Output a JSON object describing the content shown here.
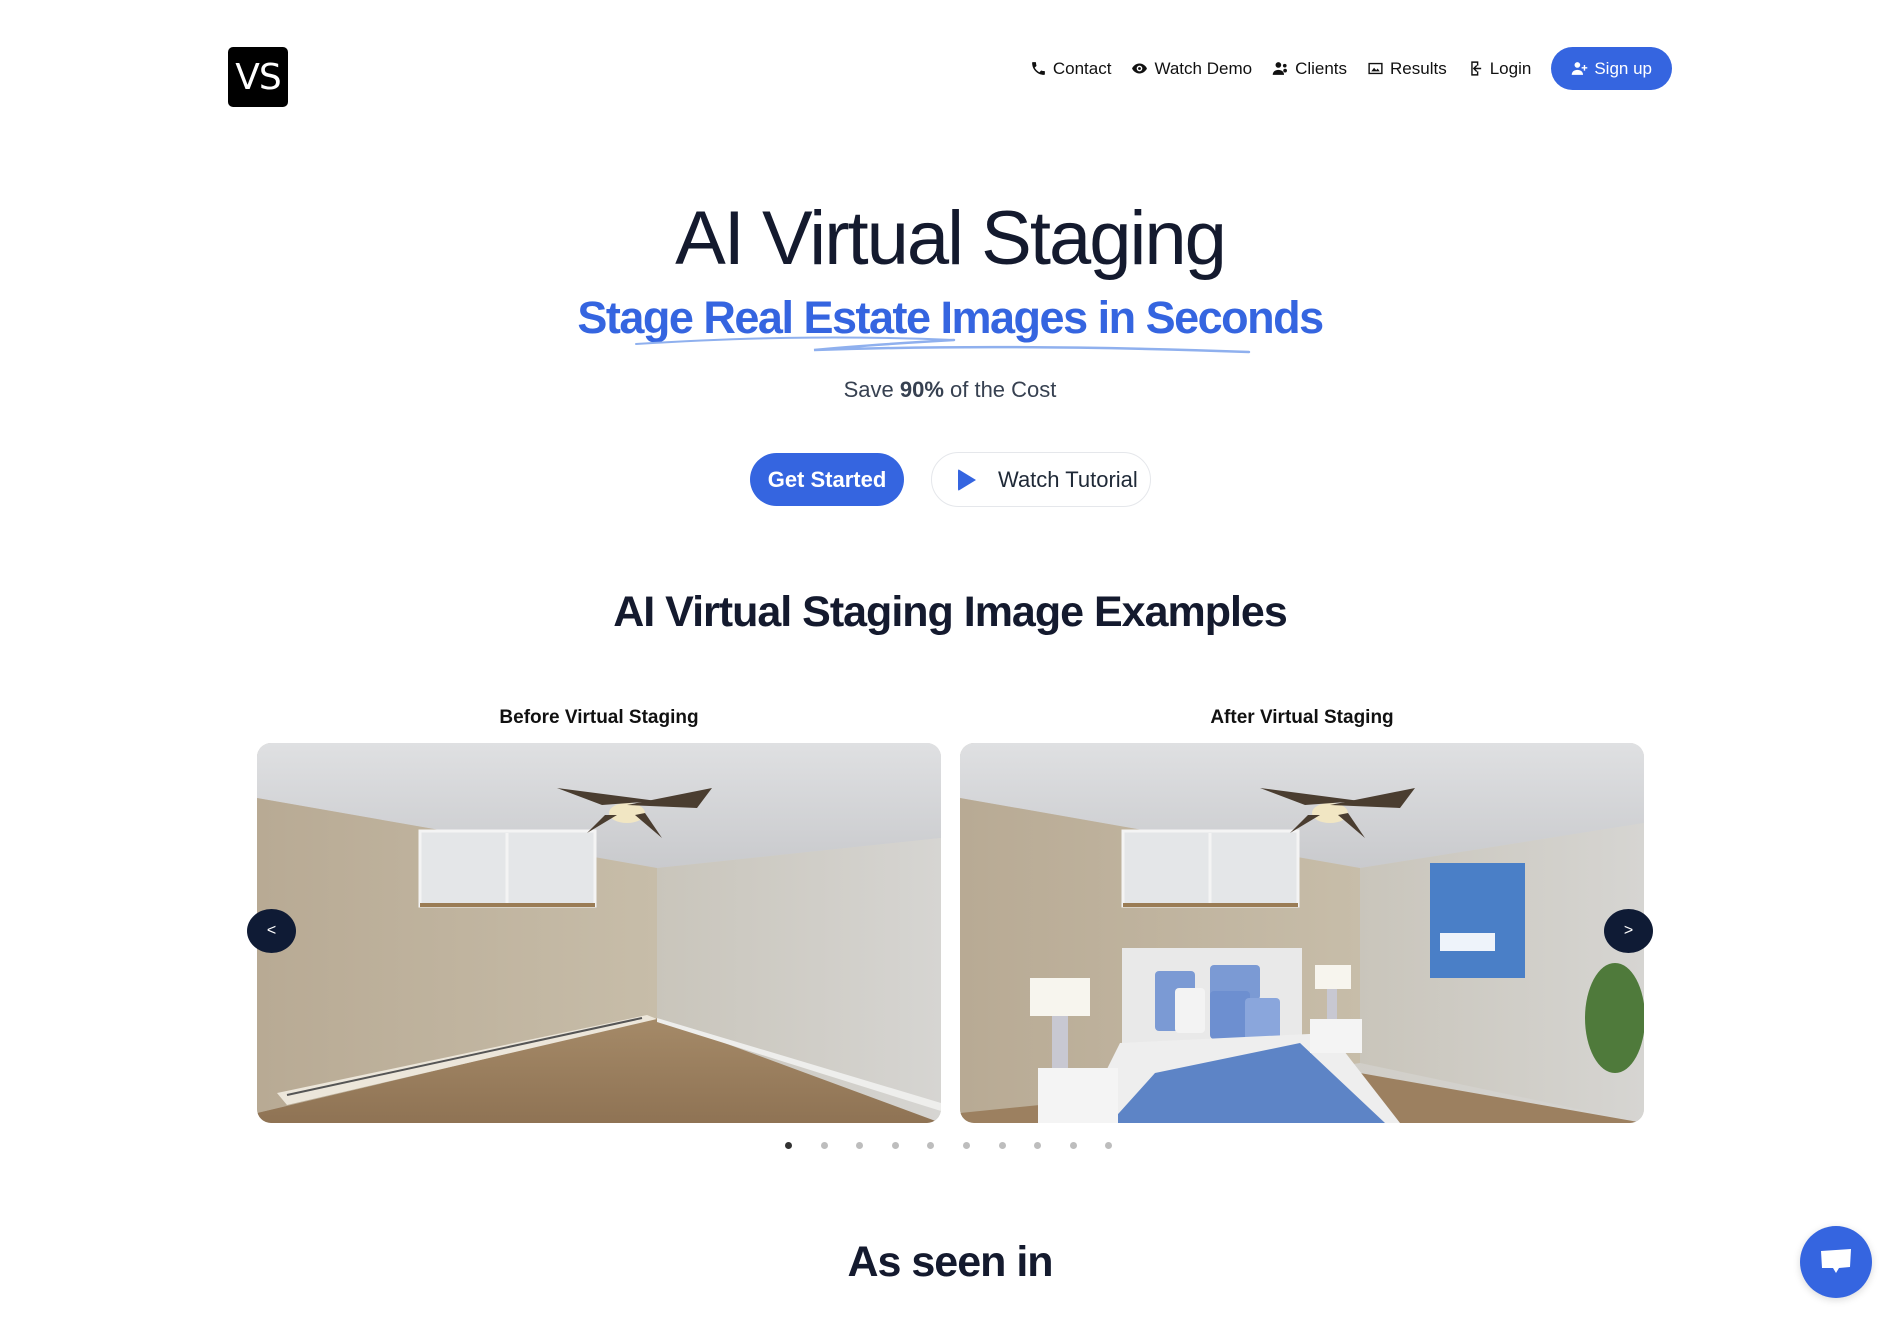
{
  "logo": {
    "text": "VS"
  },
  "nav": {
    "items": [
      {
        "label": "Contact",
        "icon": "phone-icon"
      },
      {
        "label": "Watch Demo",
        "icon": "eye-icon"
      },
      {
        "label": "Clients",
        "icon": "users-icon"
      },
      {
        "label": "Results",
        "icon": "image-icon"
      },
      {
        "label": "Login",
        "icon": "login-icon"
      }
    ],
    "signup": {
      "label": "Sign up",
      "icon": "user-plus-icon"
    }
  },
  "hero": {
    "title": "AI Virtual Staging",
    "subtitle": "Stage Real Estate Images in Seconds",
    "save_prefix": "Save ",
    "save_bold": "90%",
    "save_suffix": " of the Cost",
    "primary_button": "Get Started",
    "secondary_button": "Watch Tutorial"
  },
  "examples": {
    "title": "AI Virtual Staging Image Examples",
    "before_label": "Before Virtual Staging",
    "after_label": "After Virtual Staging",
    "prev_label": "<",
    "next_label": ">",
    "slide_count": 10,
    "active_slide": 1
  },
  "as_seen_in": {
    "title": "As seen in"
  },
  "colors": {
    "brand": "#3565e0",
    "dark": "#0f1b35",
    "text": "#141a2e"
  }
}
